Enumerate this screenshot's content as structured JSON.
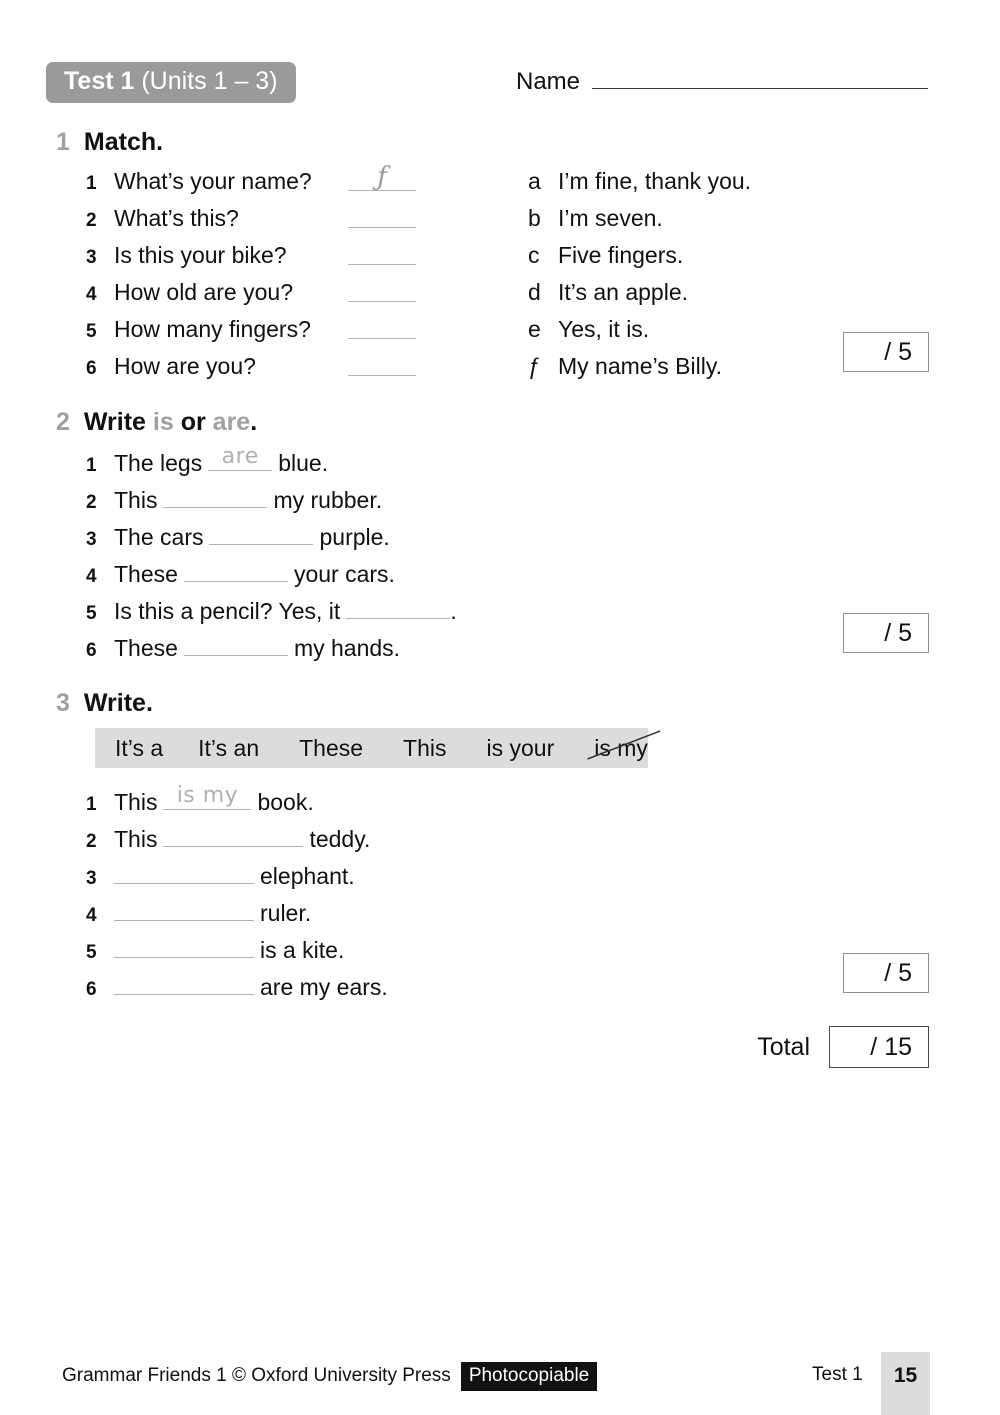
{
  "header": {
    "badge_bold": "Test 1",
    "badge_regular": "(Units 1 – 3)",
    "name_label": "Name"
  },
  "exercise1": {
    "number": "1",
    "title": "Match.",
    "left_items": [
      {
        "num": "1",
        "text": "What’s your name?",
        "answer": "ƒ"
      },
      {
        "num": "2",
        "text": "What’s this?",
        "answer": ""
      },
      {
        "num": "3",
        "text": "Is this your bike?",
        "answer": ""
      },
      {
        "num": "4",
        "text": "How old are you?",
        "answer": ""
      },
      {
        "num": "5",
        "text": "How many fingers?",
        "answer": ""
      },
      {
        "num": "6",
        "text": "How are you?",
        "answer": ""
      }
    ],
    "right_items": [
      {
        "letter": "a",
        "text": "I’m fine, thank you."
      },
      {
        "letter": "b",
        "text": "I’m seven."
      },
      {
        "letter": "c",
        "text": "Five fingers."
      },
      {
        "letter": "d",
        "text": "It’s an apple."
      },
      {
        "letter": "e",
        "text": "Yes, it is."
      },
      {
        "letter": "ƒ",
        "text": "My name’s Billy."
      }
    ],
    "score": "/ 5"
  },
  "exercise2": {
    "number": "2",
    "title_part1": "Write ",
    "title_word1": "is",
    "title_part2": " or ",
    "title_word2": "are",
    "title_part3": ".",
    "items": [
      {
        "num": "1",
        "before": "The legs",
        "fill": "are",
        "after": "blue."
      },
      {
        "num": "2",
        "before": "This",
        "fill": "",
        "after": "my rubber."
      },
      {
        "num": "3",
        "before": "The cars",
        "fill": "",
        "after": "purple."
      },
      {
        "num": "4",
        "before": "These",
        "fill": "",
        "after": "your cars."
      },
      {
        "num": "5",
        "before": "Is this a pencil? Yes, it",
        "fill": "",
        "after": "."
      },
      {
        "num": "6",
        "before": "These",
        "fill": "",
        "after": "my hands."
      }
    ],
    "score": "/ 5"
  },
  "exercise3": {
    "number": "3",
    "title": "Write.",
    "wordbank": [
      {
        "label": "It’s a",
        "struck": false
      },
      {
        "label": "It’s an",
        "struck": false
      },
      {
        "label": "These",
        "struck": false
      },
      {
        "label": "This",
        "struck": false
      },
      {
        "label": "is your",
        "struck": false
      },
      {
        "label": "is my",
        "struck": true
      }
    ],
    "items": [
      {
        "num": "1",
        "before": "This",
        "fill": "is my",
        "after": "book."
      },
      {
        "num": "2",
        "before": "This",
        "fill": "",
        "after": "teddy."
      },
      {
        "num": "3",
        "before": "",
        "fill": "",
        "after": "elephant."
      },
      {
        "num": "4",
        "before": "",
        "fill": "",
        "after": "ruler."
      },
      {
        "num": "5",
        "before": "",
        "fill": "",
        "after": "is a kite."
      },
      {
        "num": "6",
        "before": "",
        "fill": "",
        "after": "are my ears."
      }
    ],
    "score": "/ 5"
  },
  "total": {
    "label": "Total",
    "value": "/ 15"
  },
  "footer": {
    "credit": "Grammar Friends 1 © Oxford University Press",
    "photocopiable": "Photocopiable",
    "test_label": "Test 1",
    "page": "15"
  },
  "colors": {
    "badge_gray": "#9a9a9a",
    "accent_gray": "#a0a0a0",
    "blank_gray": "#b3b3b3",
    "wordbank_bg": "#dcdcdc"
  }
}
